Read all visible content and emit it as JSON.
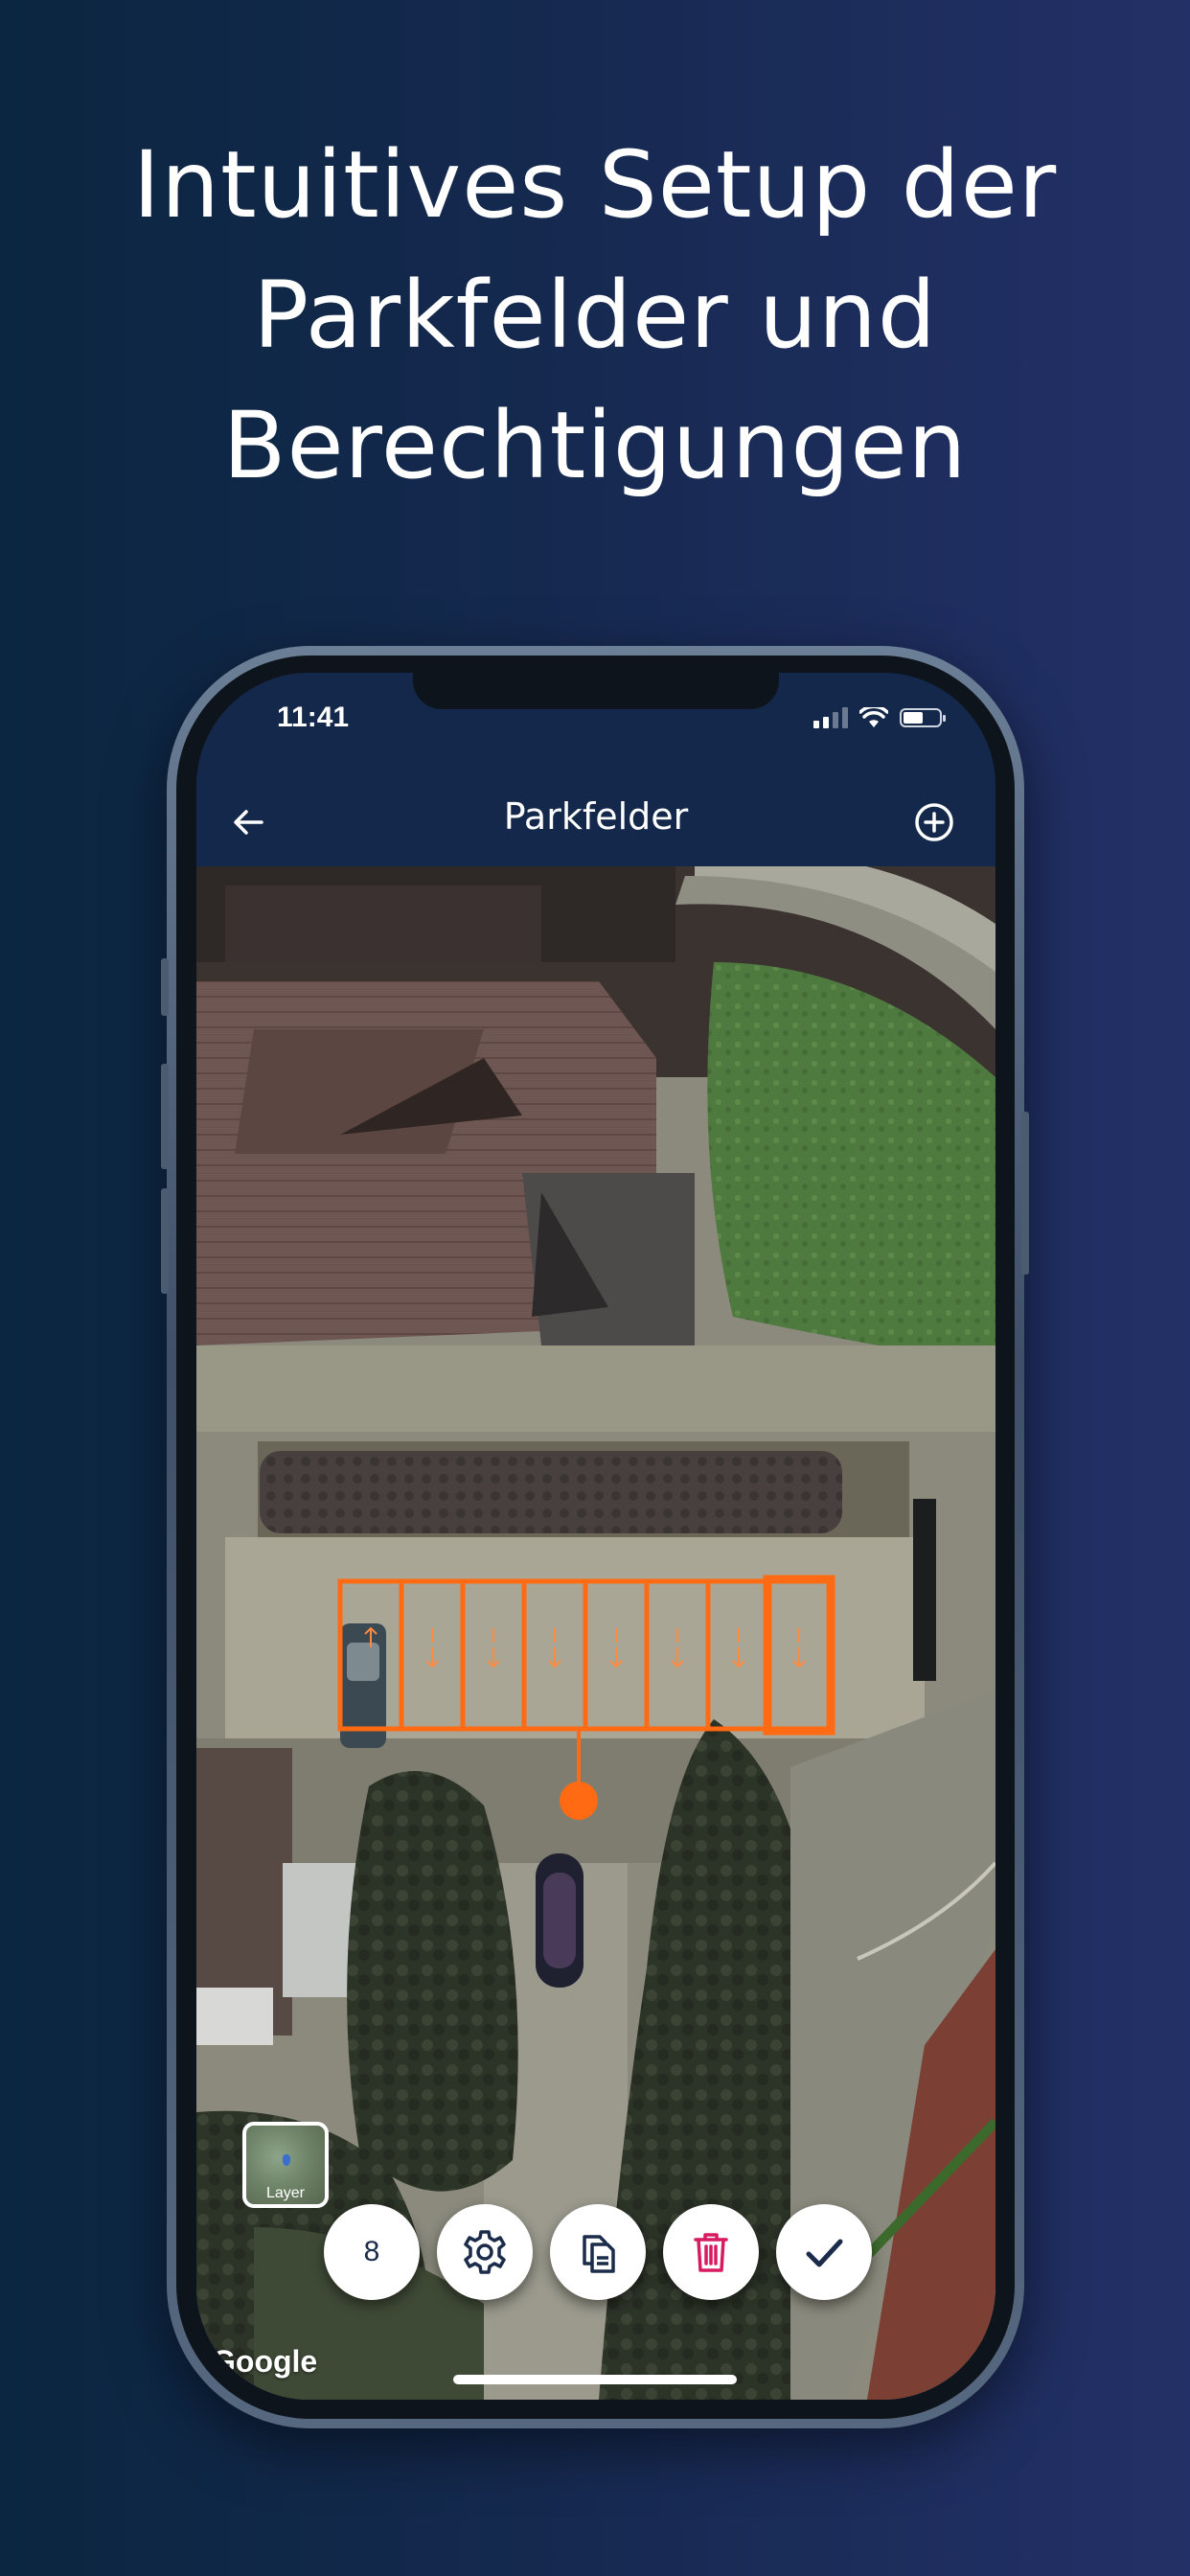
{
  "headline": {
    "line1": "Intuitives Setup der",
    "line2": "Parkfelder und",
    "line3": "Berechtigungen"
  },
  "status_bar": {
    "time": "11:41"
  },
  "nav": {
    "title": "Parkfelder",
    "back_icon": "arrow-left-icon",
    "add_icon": "plus-circle-icon"
  },
  "map": {
    "parking_spaces_count": 8,
    "selected_space_index": 8,
    "highlight_color": "#ff6a13",
    "attribution": "Google"
  },
  "layer_button": {
    "label": "Layer"
  },
  "toolbar": {
    "count_value": "8",
    "settings_icon": "gear-icon",
    "copy_icon": "copy-icon",
    "delete_icon": "trash-icon",
    "delete_color": "#d81b60",
    "confirm_icon": "check-icon"
  }
}
